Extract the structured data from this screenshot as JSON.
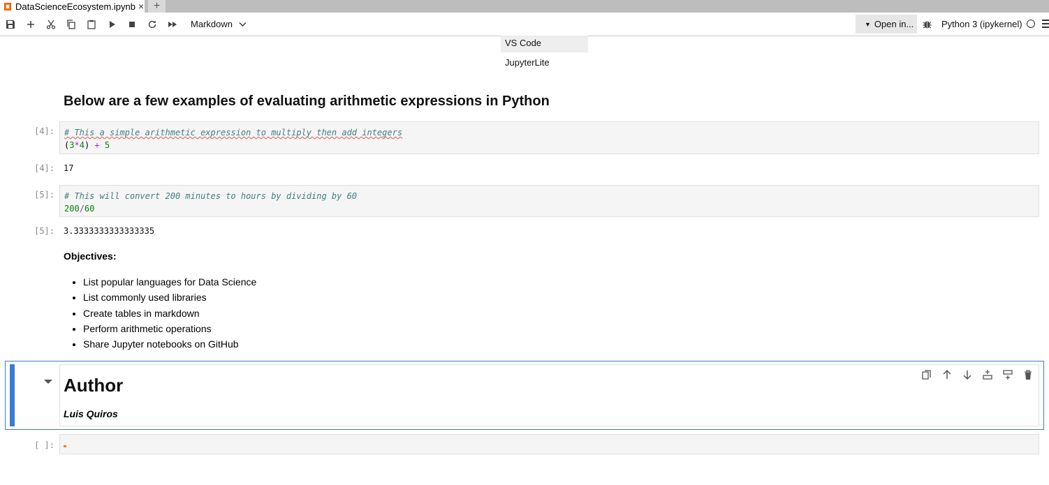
{
  "tab": {
    "title": "DataScienceEcosystem.ipynb",
    "close": "×",
    "new_tab": "+"
  },
  "toolbar": {
    "cell_type": "Markdown",
    "open_in": "Open in...",
    "kernel": "Python 3 (ipykernel)"
  },
  "open_in_menu": {
    "items": [
      "VS Code",
      "JupyterLite"
    ]
  },
  "cells": {
    "heading": "Below are a few examples of evaluating arithmetic expressions in Python",
    "code1": {
      "prompt": "[4]:",
      "comment": "# This a simple arithmetic expression to multiply then add integers",
      "line2": {
        "p1": "(",
        "n1": "3",
        "op1": "*",
        "n2": "4",
        "p2": ") ",
        "op2": "+",
        "n3": " 5"
      },
      "out_prompt": "[4]:",
      "output": "17"
    },
    "code2": {
      "prompt": "[5]:",
      "comment": "# This will convert 200 minutes to hours by dividing by 60",
      "line2": {
        "n1": "200",
        "op": "/",
        "n2": "60"
      },
      "out_prompt": "[5]:",
      "output": "3.3333333333333335"
    },
    "objectives": {
      "title": "Objectives:",
      "items": [
        "List popular languages for Data Science",
        "List commonly used libraries",
        "Create tables in markdown",
        "Perform arithmetic operations",
        "Share Jupyter notebooks on GitHub"
      ]
    },
    "author": {
      "heading": "Author",
      "name": "Luis Quiros"
    },
    "empty": {
      "prompt": "[ ]:"
    }
  },
  "colors": {
    "accent": "#3a7bd5",
    "comment": "#408080",
    "number": "#008800",
    "operator": "#aa22ff"
  }
}
